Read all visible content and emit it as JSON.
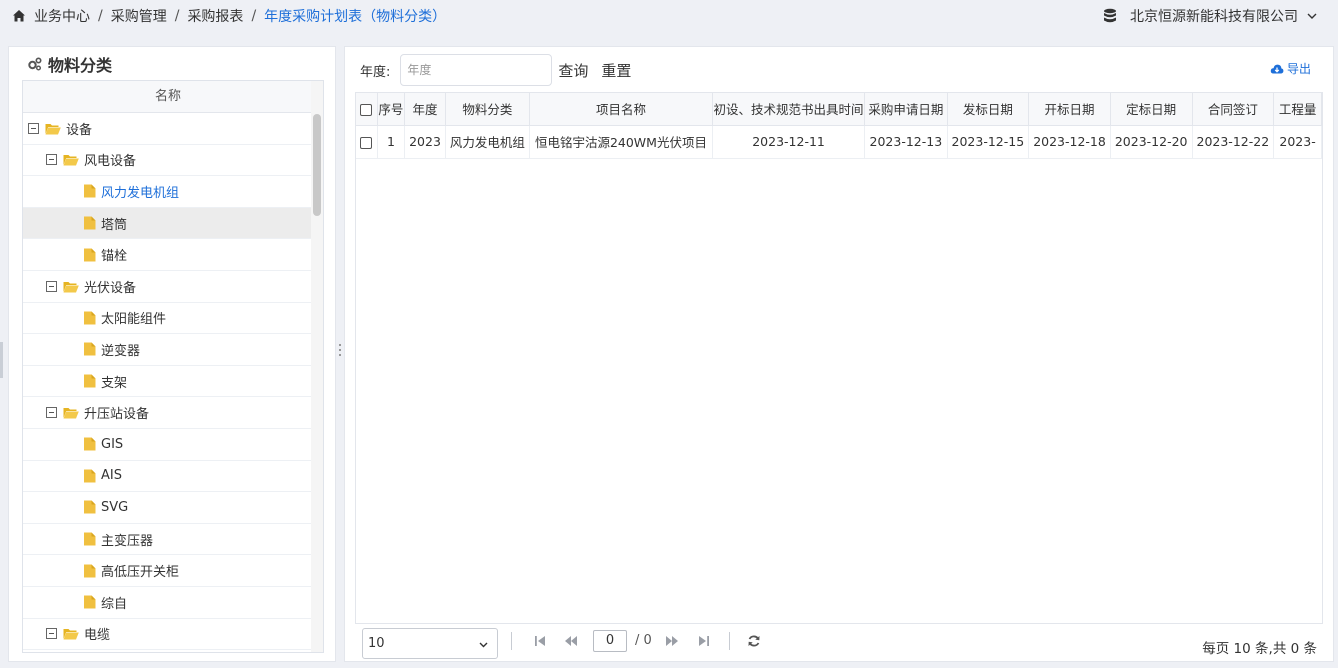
{
  "breadcrumb": {
    "items": [
      "业务中心",
      "采购管理",
      "采购报表"
    ],
    "current": "年度采购计划表（物料分类）"
  },
  "company": {
    "name": "北京恒源新能科技有限公司"
  },
  "left_panel": {
    "title": "物料分类",
    "tree_header": "名称",
    "tree": [
      {
        "label": "设备",
        "level": 0,
        "type": "folder"
      },
      {
        "label": "风电设备",
        "level": 1,
        "type": "folder"
      },
      {
        "label": "风力发电机组",
        "level": 2,
        "type": "file",
        "state": "selected"
      },
      {
        "label": "塔筒",
        "level": 2,
        "type": "file",
        "state": "hovered"
      },
      {
        "label": "锚栓",
        "level": 2,
        "type": "file"
      },
      {
        "label": "光伏设备",
        "level": 1,
        "type": "folder"
      },
      {
        "label": "太阳能组件",
        "level": 2,
        "type": "file"
      },
      {
        "label": "逆变器",
        "level": 2,
        "type": "file"
      },
      {
        "label": "支架",
        "level": 2,
        "type": "file"
      },
      {
        "label": "升压站设备",
        "level": 1,
        "type": "folder"
      },
      {
        "label": "GIS",
        "level": 2,
        "type": "file"
      },
      {
        "label": "AIS",
        "level": 2,
        "type": "file"
      },
      {
        "label": "SVG",
        "level": 2,
        "type": "file"
      },
      {
        "label": "主变压器",
        "level": 2,
        "type": "file"
      },
      {
        "label": "高低压开关柜",
        "level": 2,
        "type": "file"
      },
      {
        "label": "综自",
        "level": 2,
        "type": "file"
      },
      {
        "label": "电缆",
        "level": 1,
        "type": "folder"
      }
    ]
  },
  "filter": {
    "year_label": "年度:",
    "year_placeholder": "年度",
    "search_label": "查询",
    "reset_label": "重置",
    "export_label": "导出"
  },
  "table": {
    "columns": [
      "",
      "序号",
      "年度",
      "物料分类",
      "项目名称",
      "初设、技术规范书出具时间",
      "采购申请日期",
      "发标日期",
      "开标日期",
      "定标日期",
      "合同签订",
      "工程量"
    ],
    "rows": [
      [
        "",
        "1",
        "2023",
        "风力发电机组",
        "恒电铭宇沽源240WM光伏项目",
        "2023-12-11",
        "2023-12-13",
        "2023-12-15",
        "2023-12-18",
        "2023-12-20",
        "2023-12-22",
        "2023-"
      ]
    ]
  },
  "pager": {
    "page_size": "10",
    "current_page": "0",
    "total_pages": "/ 0",
    "summary": "每页 10 条,共 0 条"
  },
  "colors": {
    "accent": "#1e6fd9",
    "folder": "#f0c040",
    "file": "#f0c040"
  }
}
